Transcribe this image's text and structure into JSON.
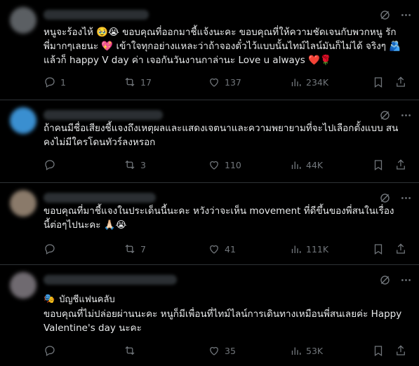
{
  "tweets": [
    {
      "text": "หนูจะร้องไห้ 🥹😭 ขอบคุณที่ออกมาชี้แจ้งนะคะ ขอบคุณที่ให้ความชัดเจนกับพวกหนู รักพี่มากๆเลยนะ 💖 เข้าใจทุกอย่างแหละว่าถ้าจองตั๋วไว้แบบนั้นไทม์ไลน์มันก็ไม่ได้ จริงๆ 🫂 แล้วก็ happy V day ค่า เจอกันวันงานกาล่านะ Love u always ❤️🌹",
      "replies": "1",
      "retweets": "17",
      "likes": "137",
      "views": "234K"
    },
    {
      "text": "ถ้าคนมีชื่อเสียงชี้แจงถึงเหตุผลและแสดงเจตนาและความพยายามที่จะไปเลือกตั้งแบบ สนคงไม่มีใครโดนทัวร์ลงหรอก",
      "replies": "",
      "retweets": "3",
      "likes": "110",
      "views": "44K"
    },
    {
      "text": "ขอบคุณที่มาชี้แจงในประเด็นนี้นะคะ หวังว่าจะเห็น movement ที่ดีขึ้นของพี่สนในเรื่อง นี้ต่อๆไปนะคะ 🙏🏻😭",
      "replies": "",
      "retweets": "7",
      "likes": "41",
      "views": "111K"
    },
    {
      "badge": "บัญชีแฟนคลับ",
      "text": "ขอบคุณที่ไม่ปล่อยผ่านนะคะ หนูก็มีเพื่อนที่ไทม์ไลน์การเดินทางเหมือนพี่สนเลยค่ะ Happy Valentine's day นะคะ",
      "replies": "",
      "retweets": "",
      "likes": "35",
      "views": "53K"
    }
  ]
}
